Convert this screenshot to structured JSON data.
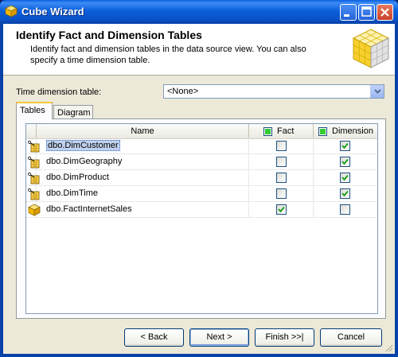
{
  "window": {
    "title": "Cube Wizard"
  },
  "header": {
    "title": "Identify Fact and Dimension Tables",
    "description": "Identify fact and dimension tables in the data source view. You can also specify a time dimension table."
  },
  "time_dimension": {
    "label": "Time dimension table:",
    "value": "<None>"
  },
  "tabs": [
    {
      "label": "Tables",
      "active": true
    },
    {
      "label": "Diagram",
      "active": false
    }
  ],
  "grid": {
    "columns": {
      "name": "Name",
      "fact": "Fact",
      "dimension": "Dimension"
    },
    "rows": [
      {
        "name": "dbo.DimCustomer",
        "fact": false,
        "dimension": true,
        "icon": "dimension-table-icon",
        "selected": true
      },
      {
        "name": "dbo.DimGeography",
        "fact": false,
        "dimension": true,
        "icon": "dimension-table-icon",
        "selected": false
      },
      {
        "name": "dbo.DimProduct",
        "fact": false,
        "dimension": true,
        "icon": "dimension-table-icon",
        "selected": false
      },
      {
        "name": "dbo.DimTime",
        "fact": false,
        "dimension": true,
        "icon": "dimension-table-icon",
        "selected": false
      },
      {
        "name": "dbo.FactInternetSales",
        "fact": true,
        "dimension": false,
        "icon": "fact-table-icon",
        "selected": false
      }
    ]
  },
  "buttons": {
    "back": "< Back",
    "next": "Next >",
    "finish": "Finish >>|",
    "cancel": "Cancel"
  },
  "colors": {
    "titlebar": "#0a5fe0",
    "check": "#21a121",
    "selection": "#c1d2ee",
    "dialog_bg": "#ece9d8"
  }
}
